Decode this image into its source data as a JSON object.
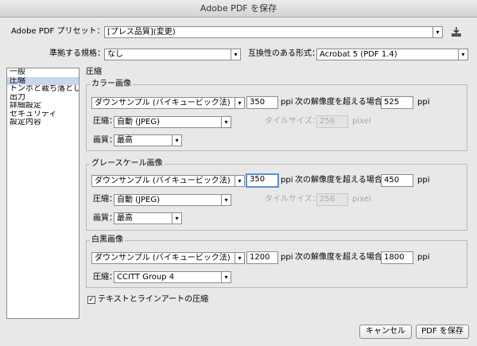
{
  "window": {
    "title": "Adobe PDF を保存"
  },
  "preset": {
    "label": "Adobe PDF プリセット：",
    "value": "[プレス品質](変更)"
  },
  "standard": {
    "label": "準拠する規格：",
    "value": "なし"
  },
  "compatibility": {
    "label": "互換性のある形式：",
    "value": "Acrobat 5 (PDF 1.4)"
  },
  "sidebar": {
    "items": [
      {
        "label": "一般"
      },
      {
        "label": "圧縮"
      },
      {
        "label": "トンボと裁ち落とし"
      },
      {
        "label": "出力"
      },
      {
        "label": "詳細設定"
      },
      {
        "label": "セキュリティ"
      },
      {
        "label": "設定内容"
      }
    ]
  },
  "section_title": "圧縮",
  "color": {
    "title": "カラー画像",
    "sampling": "ダウンサンプル (バイキュービック法)",
    "ppi": "350",
    "ppi_unit": "ppi",
    "threshold_label": "次の解像度を超える場合",
    "threshold": "525",
    "threshold_unit": "ppi",
    "compression_label": "圧縮：",
    "compression": "自動 (JPEG)",
    "tile_label": "タイルサイズ：",
    "tile": "256",
    "tile_unit": "pixel",
    "quality_label": "画質：",
    "quality": "最高"
  },
  "gray": {
    "title": "グレースケール画像",
    "sampling": "ダウンサンプル (バイキュービック法)",
    "ppi": "350",
    "ppi_unit": "ppi",
    "threshold_label": "次の解像度を超える場合",
    "threshold": "450",
    "threshold_unit": "ppi",
    "compression_label": "圧縮：",
    "compression": "自動 (JPEG)",
    "tile_label": "タイルサイズ：",
    "tile": "256",
    "tile_unit": "pixel",
    "quality_label": "画質：",
    "quality": "最高"
  },
  "mono": {
    "title": "白黒画像",
    "sampling": "ダウンサンプル (バイキュービック法)",
    "ppi": "1200",
    "ppi_unit": "ppi",
    "threshold_label": "次の解像度を超える場合",
    "threshold": "1800",
    "threshold_unit": "ppi",
    "compression_label": "圧縮：",
    "compression": "CCITT Group 4"
  },
  "text_lineart": {
    "label": "テキストとラインアートの圧縮",
    "checked": "✓"
  },
  "buttons": {
    "cancel": "キャンセル",
    "save": "PDF を保存"
  },
  "icons": {
    "dropdown": "▾",
    "save_preset": "save-preset-icon"
  }
}
